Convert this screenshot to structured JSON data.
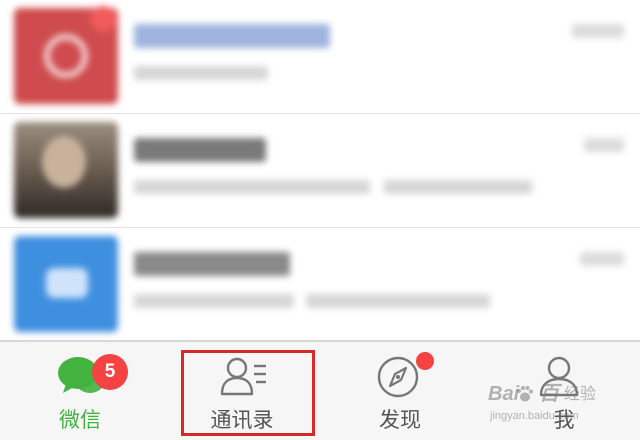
{
  "colors": {
    "active_tab": "#43b340",
    "inactive_tab": "#555555",
    "badge": "#f54343",
    "highlight": "#d62a2a",
    "tabbar_bg": "#f6f6f6"
  },
  "chat_list": {
    "rows": [
      {
        "avatar": "red-logo",
        "has_badge": true
      },
      {
        "avatar": "person-photo",
        "has_badge": false
      },
      {
        "avatar": "blue-chat-icon",
        "has_badge": false
      }
    ]
  },
  "tab_bar": {
    "tabs": [
      {
        "label": "微信",
        "icon": "chat-bubbles-icon",
        "active": true,
        "badge_count": "5"
      },
      {
        "label": "通讯录",
        "icon": "contacts-icon",
        "active": false,
        "highlighted": true
      },
      {
        "label": "发现",
        "icon": "compass-icon",
        "active": false,
        "dot_badge": true
      },
      {
        "label": "我",
        "icon": "person-icon",
        "active": false
      }
    ]
  },
  "watermark": {
    "logo": "Bai",
    "logo_tail": "百",
    "sub": "经验",
    "url": "jingyan.baidu.com"
  }
}
